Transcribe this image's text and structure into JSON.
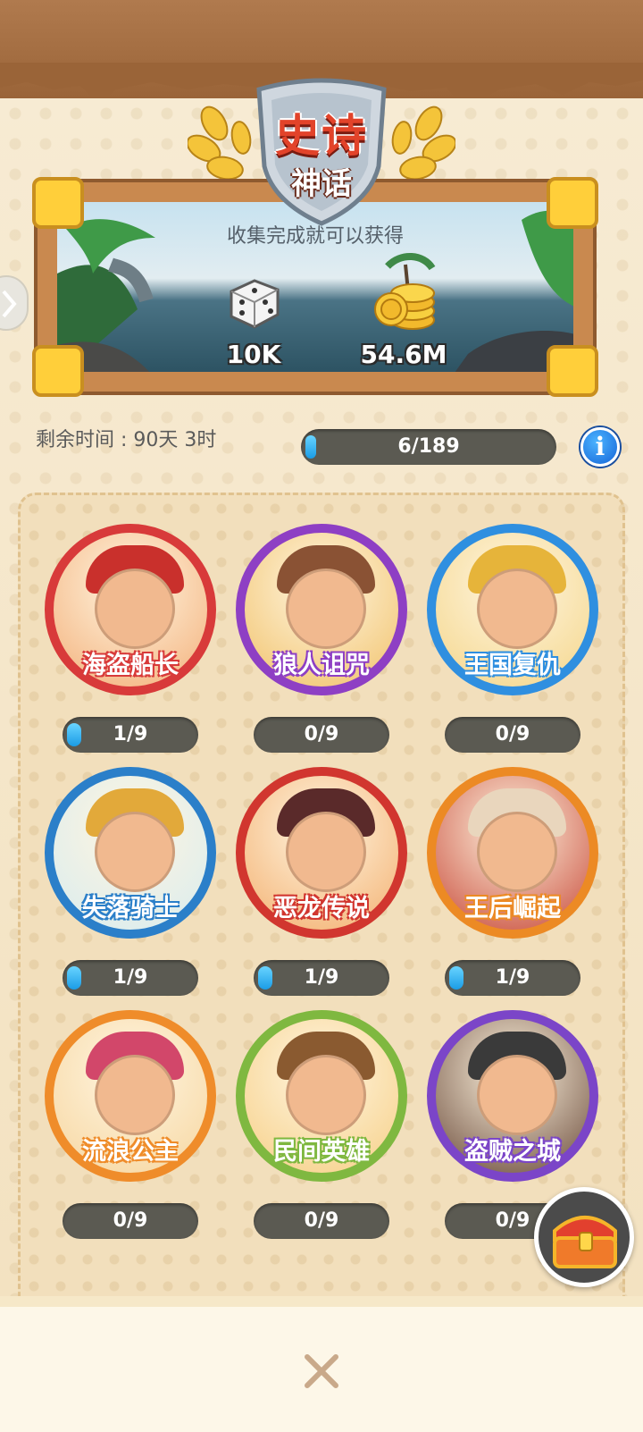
{
  "header": {
    "title": "史诗",
    "subtitle": "神话"
  },
  "banner": {
    "caption": "收集完成就可以获得",
    "rewards": [
      {
        "icon": "dice-icon",
        "label": "10K"
      },
      {
        "icon": "coins-icon",
        "label": "54.6M"
      }
    ]
  },
  "status": {
    "time_remaining": "剩余时间 : 90天 3时",
    "overall_progress": {
      "text": "6/189",
      "value": 6,
      "total": 189
    },
    "info_icon": "info-icon"
  },
  "collections": [
    {
      "name": "海盗船长",
      "progress": "1/9",
      "value": 1,
      "total": 9,
      "ring": "#d83a3a",
      "hat": "#c9302c",
      "bg": "#f3b07a"
    },
    {
      "name": "狼人诅咒",
      "progress": "0/9",
      "value": 0,
      "total": 9,
      "ring": "#8e3fc4",
      "hat": "#8a5234",
      "bg": "#f1c26a"
    },
    {
      "name": "王国复仇",
      "progress": "0/9",
      "value": 0,
      "total": 9,
      "ring": "#2f8fe0",
      "hat": "#e6b43a",
      "bg": "#f4d68a"
    },
    {
      "name": "失落骑士",
      "progress": "1/9",
      "value": 1,
      "total": 9,
      "ring": "#2b7fc9",
      "hat": "#e2a93a",
      "bg": "#d8ecef"
    },
    {
      "name": "恶龙传说",
      "progress": "1/9",
      "value": 1,
      "total": 9,
      "ring": "#d1362f",
      "hat": "#5a2a2a",
      "bg": "#f3b070"
    },
    {
      "name": "王后崛起",
      "progress": "1/9",
      "value": 1,
      "total": 9,
      "ring": "#ec8a24",
      "hat": "#e9d6bd",
      "bg": "#c84a3a"
    },
    {
      "name": "流浪公主",
      "progress": "0/9",
      "value": 0,
      "total": 9,
      "ring": "#ef8c2a",
      "hat": "#d2476a",
      "bg": "#f6d6a0"
    },
    {
      "name": "民间英雄",
      "progress": "0/9",
      "value": 0,
      "total": 9,
      "ring": "#7fb840",
      "hat": "#8a5a30",
      "bg": "#f6cf86"
    },
    {
      "name": "盗贼之城",
      "progress": "0/9",
      "value": 0,
      "total": 9,
      "ring": "#7b45c8",
      "hat": "#3a3a3a",
      "bg": "#6a4a3a"
    }
  ],
  "icons": {
    "chest": "treasure-chest-icon",
    "close": "close-icon",
    "side": "chevron-left-icon"
  },
  "colors": {
    "progress_fill": "#1a9ce6",
    "progress_track": "#5b5a52",
    "title_red": "#e2432a"
  }
}
